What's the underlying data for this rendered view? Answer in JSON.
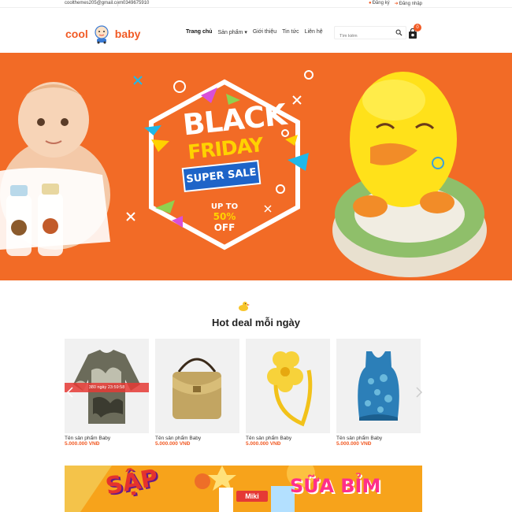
{
  "topbar": {
    "email": "coolthemes205@gmail.com",
    "phone": "0349675910",
    "register": "Đăng ký",
    "login": "Đăng nhập"
  },
  "header": {
    "logo_left": "cool",
    "logo_right": "baby",
    "nav": [
      "Trang chủ",
      "Sản phẩm",
      "Giới thiệu",
      "Tin tức",
      "Liên hệ"
    ],
    "search_placeholder": "Tìm kiếm",
    "cart_count": "0"
  },
  "banner": {
    "black": "BLACK",
    "friday": "FRIDAY",
    "super_sale": "SUPER SALE",
    "up_to": "UP TO",
    "percent": "50%",
    "off": "OFF"
  },
  "deals": {
    "title": "Hot deal mỗi ngày",
    "countdown": "380 ngày 23:59:58",
    "products": [
      {
        "name": "Tên sản phẩm Baby",
        "price": "5.000.000 VNĐ",
        "image": "camo-sweater"
      },
      {
        "name": "Tên sản phẩm Baby",
        "price": "5.000.000 VNĐ",
        "image": "gold-handbag"
      },
      {
        "name": "Tên sản phẩm Baby",
        "price": "5.000.000 VNĐ",
        "image": "yellow-flower-headband"
      },
      {
        "name": "Tên sản phẩm Baby",
        "price": "5.000.000 VNĐ",
        "image": "blue-tank-top"
      }
    ]
  },
  "promo": {
    "left_text": "SẬP",
    "right_text": "SỮA BỈM",
    "brand": "Miki"
  },
  "colors": {
    "accent": "#f15a24",
    "banner_bg": "#f26b26",
    "promo_bg": "#f7a31b"
  }
}
